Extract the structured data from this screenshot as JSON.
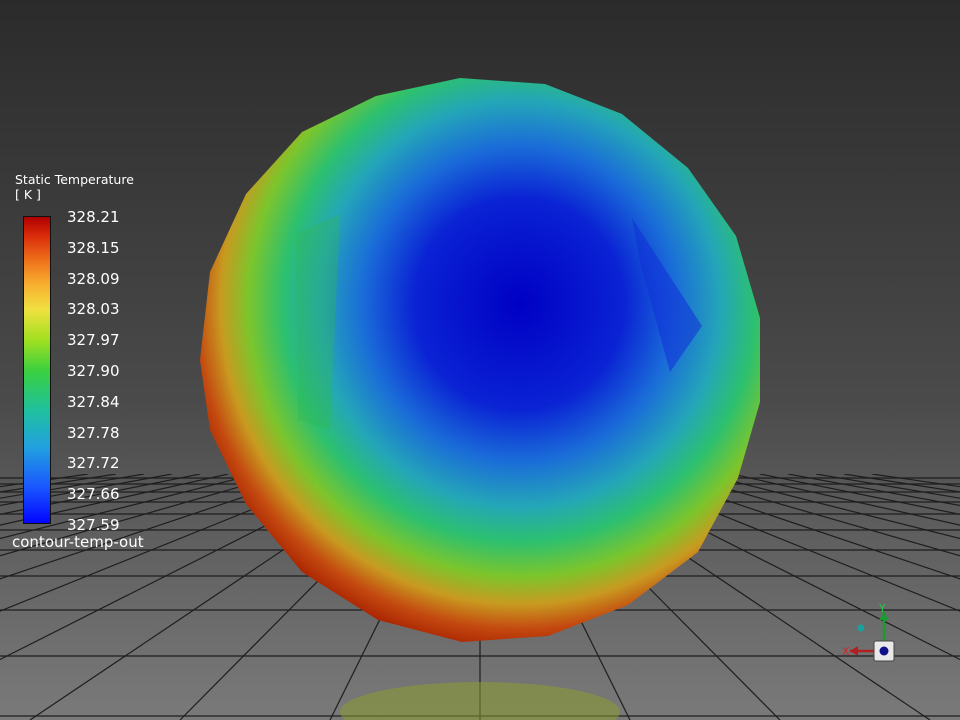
{
  "legend": {
    "title": "Static Temperature",
    "units": "[ K ]",
    "values": [
      "328.21",
      "328.15",
      "328.09",
      "328.03",
      "327.97",
      "327.90",
      "327.84",
      "327.78",
      "327.72",
      "327.66",
      "327.59"
    ],
    "caption": "contour-temp-out",
    "colormap": [
      "#0000ff",
      "#1a6aff",
      "#2ab0c8",
      "#2bc86a",
      "#9be22a",
      "#f0e040",
      "#f5a030",
      "#e86018",
      "#c81e0a",
      "#a80000"
    ]
  },
  "colors": {
    "background_top": "#2a2a2a",
    "background_bottom": "#7a7a7a",
    "sphere_center": "#0000c8",
    "sphere_rim": "#a82000"
  },
  "triad": {
    "x_label": "X",
    "y_label": "Y",
    "icons": [
      "axis-triad-icon"
    ]
  }
}
